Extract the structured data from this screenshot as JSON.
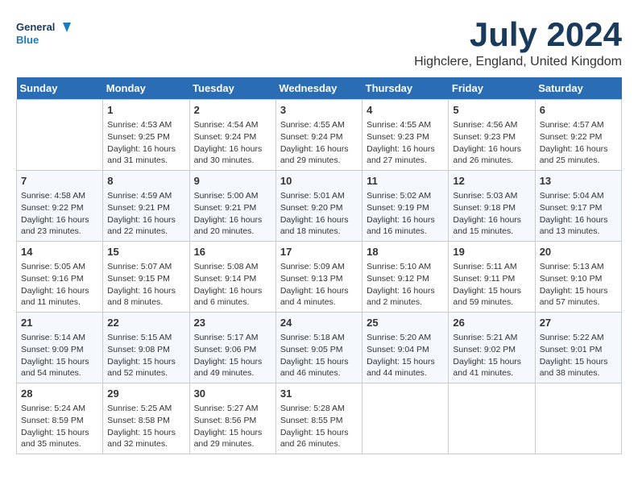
{
  "header": {
    "logo_line1": "General",
    "logo_line2": "Blue",
    "month": "July 2024",
    "location": "Highclere, England, United Kingdom"
  },
  "weekdays": [
    "Sunday",
    "Monday",
    "Tuesday",
    "Wednesday",
    "Thursday",
    "Friday",
    "Saturday"
  ],
  "weeks": [
    [
      {
        "day": "",
        "content": ""
      },
      {
        "day": "1",
        "content": "Sunrise: 4:53 AM\nSunset: 9:25 PM\nDaylight: 16 hours\nand 31 minutes."
      },
      {
        "day": "2",
        "content": "Sunrise: 4:54 AM\nSunset: 9:24 PM\nDaylight: 16 hours\nand 30 minutes."
      },
      {
        "day": "3",
        "content": "Sunrise: 4:55 AM\nSunset: 9:24 PM\nDaylight: 16 hours\nand 29 minutes."
      },
      {
        "day": "4",
        "content": "Sunrise: 4:55 AM\nSunset: 9:23 PM\nDaylight: 16 hours\nand 27 minutes."
      },
      {
        "day": "5",
        "content": "Sunrise: 4:56 AM\nSunset: 9:23 PM\nDaylight: 16 hours\nand 26 minutes."
      },
      {
        "day": "6",
        "content": "Sunrise: 4:57 AM\nSunset: 9:22 PM\nDaylight: 16 hours\nand 25 minutes."
      }
    ],
    [
      {
        "day": "7",
        "content": "Sunrise: 4:58 AM\nSunset: 9:22 PM\nDaylight: 16 hours\nand 23 minutes."
      },
      {
        "day": "8",
        "content": "Sunrise: 4:59 AM\nSunset: 9:21 PM\nDaylight: 16 hours\nand 22 minutes."
      },
      {
        "day": "9",
        "content": "Sunrise: 5:00 AM\nSunset: 9:21 PM\nDaylight: 16 hours\nand 20 minutes."
      },
      {
        "day": "10",
        "content": "Sunrise: 5:01 AM\nSunset: 9:20 PM\nDaylight: 16 hours\nand 18 minutes."
      },
      {
        "day": "11",
        "content": "Sunrise: 5:02 AM\nSunset: 9:19 PM\nDaylight: 16 hours\nand 16 minutes."
      },
      {
        "day": "12",
        "content": "Sunrise: 5:03 AM\nSunset: 9:18 PM\nDaylight: 16 hours\nand 15 minutes."
      },
      {
        "day": "13",
        "content": "Sunrise: 5:04 AM\nSunset: 9:17 PM\nDaylight: 16 hours\nand 13 minutes."
      }
    ],
    [
      {
        "day": "14",
        "content": "Sunrise: 5:05 AM\nSunset: 9:16 PM\nDaylight: 16 hours\nand 11 minutes."
      },
      {
        "day": "15",
        "content": "Sunrise: 5:07 AM\nSunset: 9:15 PM\nDaylight: 16 hours\nand 8 minutes."
      },
      {
        "day": "16",
        "content": "Sunrise: 5:08 AM\nSunset: 9:14 PM\nDaylight: 16 hours\nand 6 minutes."
      },
      {
        "day": "17",
        "content": "Sunrise: 5:09 AM\nSunset: 9:13 PM\nDaylight: 16 hours\nand 4 minutes."
      },
      {
        "day": "18",
        "content": "Sunrise: 5:10 AM\nSunset: 9:12 PM\nDaylight: 16 hours\nand 2 minutes."
      },
      {
        "day": "19",
        "content": "Sunrise: 5:11 AM\nSunset: 9:11 PM\nDaylight: 15 hours\nand 59 minutes."
      },
      {
        "day": "20",
        "content": "Sunrise: 5:13 AM\nSunset: 9:10 PM\nDaylight: 15 hours\nand 57 minutes."
      }
    ],
    [
      {
        "day": "21",
        "content": "Sunrise: 5:14 AM\nSunset: 9:09 PM\nDaylight: 15 hours\nand 54 minutes."
      },
      {
        "day": "22",
        "content": "Sunrise: 5:15 AM\nSunset: 9:08 PM\nDaylight: 15 hours\nand 52 minutes."
      },
      {
        "day": "23",
        "content": "Sunrise: 5:17 AM\nSunset: 9:06 PM\nDaylight: 15 hours\nand 49 minutes."
      },
      {
        "day": "24",
        "content": "Sunrise: 5:18 AM\nSunset: 9:05 PM\nDaylight: 15 hours\nand 46 minutes."
      },
      {
        "day": "25",
        "content": "Sunrise: 5:20 AM\nSunset: 9:04 PM\nDaylight: 15 hours\nand 44 minutes."
      },
      {
        "day": "26",
        "content": "Sunrise: 5:21 AM\nSunset: 9:02 PM\nDaylight: 15 hours\nand 41 minutes."
      },
      {
        "day": "27",
        "content": "Sunrise: 5:22 AM\nSunset: 9:01 PM\nDaylight: 15 hours\nand 38 minutes."
      }
    ],
    [
      {
        "day": "28",
        "content": "Sunrise: 5:24 AM\nSunset: 8:59 PM\nDaylight: 15 hours\nand 35 minutes."
      },
      {
        "day": "29",
        "content": "Sunrise: 5:25 AM\nSunset: 8:58 PM\nDaylight: 15 hours\nand 32 minutes."
      },
      {
        "day": "30",
        "content": "Sunrise: 5:27 AM\nSunset: 8:56 PM\nDaylight: 15 hours\nand 29 minutes."
      },
      {
        "day": "31",
        "content": "Sunrise: 5:28 AM\nSunset: 8:55 PM\nDaylight: 15 hours\nand 26 minutes."
      },
      {
        "day": "",
        "content": ""
      },
      {
        "day": "",
        "content": ""
      },
      {
        "day": "",
        "content": ""
      }
    ]
  ]
}
